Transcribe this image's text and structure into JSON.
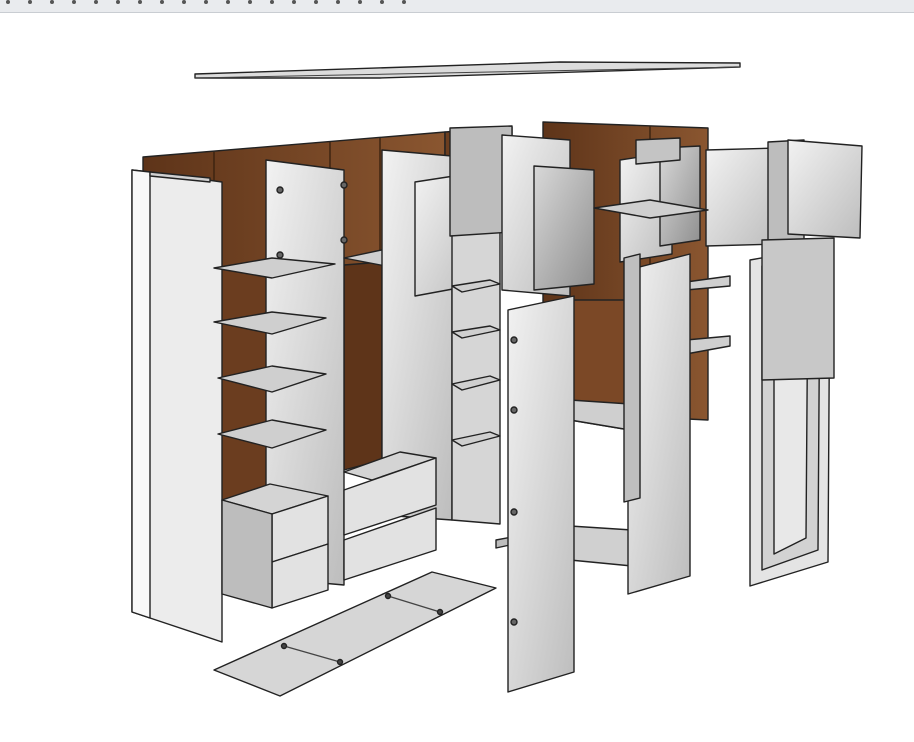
{
  "view": {
    "kind": "exploded 3D model of a walk-in wardrobe",
    "colors": {
      "background": "#ffffff",
      "toolbar": "#e9ebee",
      "back_panel_wood": "#6b3d1f",
      "back_panel_wood_light": "#8a5630",
      "panel_light": "#e6e6e6",
      "panel_mid": "#cfcfcf",
      "panel_dark": "#a9a9a9",
      "outline": "#222222"
    },
    "toolbar_dot_count": 19
  }
}
